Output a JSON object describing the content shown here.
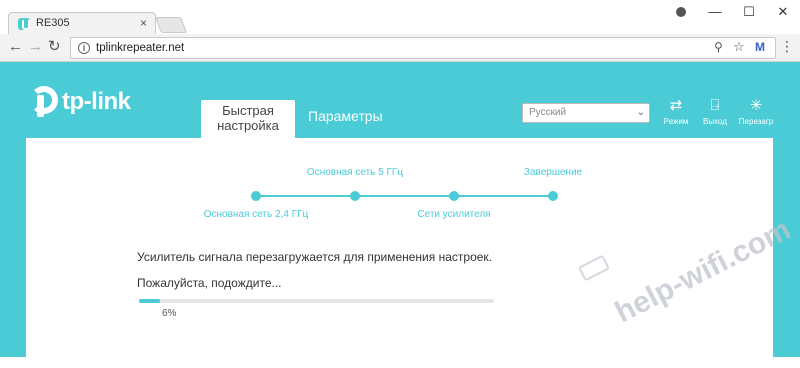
{
  "browser": {
    "tab_title": "RE305",
    "url": "tplinkrepeater.net",
    "tab_close": "×",
    "window_controls": [
      "—",
      "☐",
      "✕"
    ]
  },
  "header": {
    "logo_text": "tp-link",
    "tabs": [
      {
        "label": "Быстрая настройка",
        "active": true
      },
      {
        "label": "Параметры",
        "active": false
      }
    ],
    "language": {
      "selected": "Русский"
    },
    "actions": [
      {
        "icon": "mode-icon",
        "label": "Режим"
      },
      {
        "icon": "logout-icon",
        "label": "Выход"
      },
      {
        "icon": "reboot-icon",
        "label": "Перезагр"
      }
    ]
  },
  "steps": [
    {
      "label": "Основная сеть 2,4 ГГц",
      "position": "below"
    },
    {
      "label": "Основная сеть 5 ГГц",
      "position": "above"
    },
    {
      "label": "Сети усилителя",
      "position": "below"
    },
    {
      "label": "Завершение",
      "position": "above"
    }
  ],
  "status": {
    "message": "Усилитель сигнала перезагружается для применения настроек.",
    "wait_message": "Пожалуйста, подождите...",
    "progress_percent": 6,
    "progress_text": "6%"
  },
  "watermark": "help-wifi.com",
  "colors": {
    "accent": "#4acbd6",
    "content_bg": "#ffffff"
  }
}
